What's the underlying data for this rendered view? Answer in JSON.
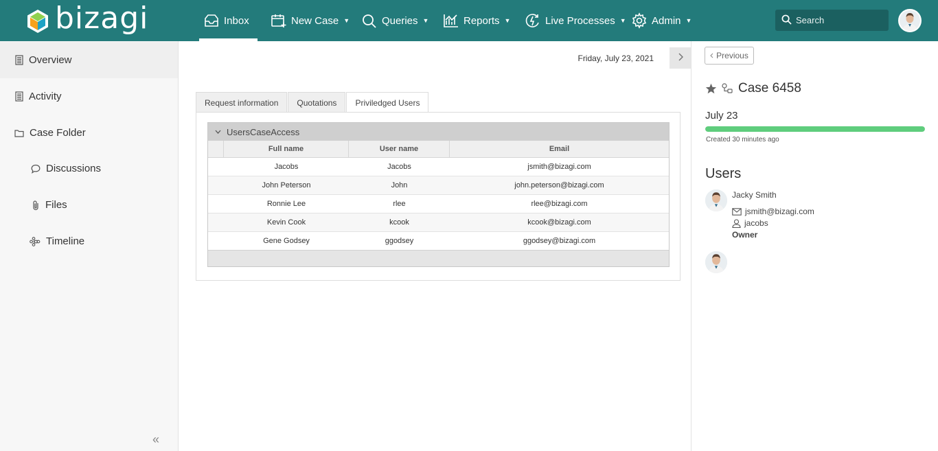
{
  "brand": {
    "name": "bizagi"
  },
  "nav": {
    "items": [
      {
        "label": "Inbox"
      },
      {
        "label": "New Case"
      },
      {
        "label": "Queries"
      },
      {
        "label": "Reports"
      },
      {
        "label": "Live Processes"
      },
      {
        "label": "Admin"
      }
    ],
    "search_placeholder": "Search",
    "active": "Inbox"
  },
  "sidebar": {
    "items": [
      {
        "label": "Overview",
        "icon": "document-icon"
      },
      {
        "label": "Activity",
        "icon": "document-icon"
      },
      {
        "label": "Case Folder",
        "icon": "folder-icon"
      },
      {
        "label": "Discussions",
        "icon": "chat-bubble-icon"
      },
      {
        "label": "Files",
        "icon": "paperclip-icon"
      },
      {
        "label": "Timeline",
        "icon": "timeline-icon"
      }
    ],
    "collapse_symbol": "«"
  },
  "main": {
    "date": "Friday, July 23, 2021",
    "tabs": [
      {
        "label": "Request information"
      },
      {
        "label": "Quotations"
      },
      {
        "label": "Priviledged Users"
      }
    ],
    "active_tab": "Priviledged Users",
    "grid": {
      "title": "UsersCaseAccess",
      "columns": [
        "Full name",
        "User name",
        "Email"
      ],
      "rows": [
        {
          "full_name": "Jacobs",
          "user_name": "Jacobs",
          "email": "jsmith@bizagi.com"
        },
        {
          "full_name": "John Peterson",
          "user_name": "John",
          "email": "john.peterson@bizagi.com"
        },
        {
          "full_name": "Ronnie Lee",
          "user_name": "rlee",
          "email": "rlee@bizagi.com"
        },
        {
          "full_name": "Kevin Cook",
          "user_name": "kcook",
          "email": "kcook@bizagi.com"
        },
        {
          "full_name": "Gene Godsey",
          "user_name": "ggodsey",
          "email": "ggodsey@bizagi.com"
        }
      ]
    }
  },
  "right": {
    "previous_label": "Previous",
    "case_title": "Case 6458",
    "case_date": "July 23",
    "progress_percent": 100,
    "created": "Created 30 minutes ago",
    "users_title": "Users",
    "user": {
      "name": "Jacky Smith",
      "email": "jsmith@bizagi.com",
      "username": "jacobs",
      "role": "Owner"
    }
  },
  "colors": {
    "topbar": "#237b7b",
    "progress": "#5fcd7d"
  }
}
